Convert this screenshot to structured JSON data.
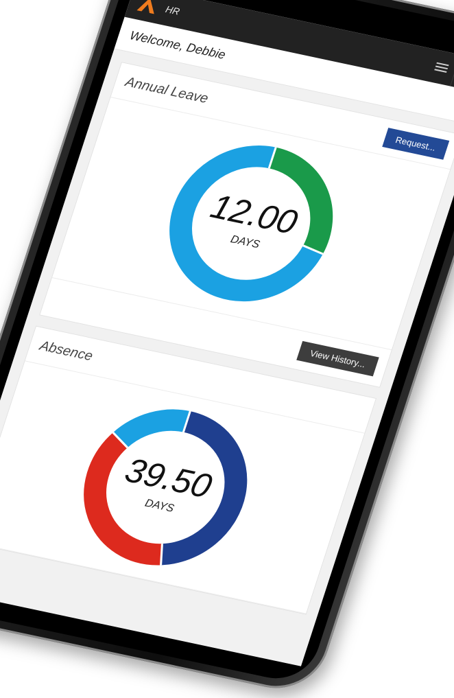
{
  "app": {
    "title": "HR"
  },
  "welcome": {
    "text": "Welcome, Debbie"
  },
  "annual_leave": {
    "title": "Annual Leave",
    "request_label": "Request...",
    "value": "12.00",
    "unit": "DAYS",
    "history_label": "View History...",
    "segments": [
      {
        "name": "taken",
        "fraction": 0.28,
        "color": "#1a9a4a"
      },
      {
        "name": "remaining",
        "fraction": 0.72,
        "color": "#1ba1e2"
      }
    ]
  },
  "absence": {
    "title": "Absence",
    "value": "39.50",
    "unit": "DAYS",
    "segments": [
      {
        "name": "segment-a",
        "fraction": 0.46,
        "color": "#1f3f8f"
      },
      {
        "name": "segment-b",
        "fraction": 0.38,
        "color": "#dd2a1e"
      },
      {
        "name": "segment-c",
        "fraction": 0.16,
        "color": "#1ba1e2"
      }
    ]
  },
  "colors": {
    "appbar": "#222222",
    "logo": "#f07c1e",
    "primary_button": "#234a96"
  },
  "icons": {
    "logo": "arrow-a-logo",
    "menu": "hamburger-icon",
    "more": "kebab-icon"
  }
}
